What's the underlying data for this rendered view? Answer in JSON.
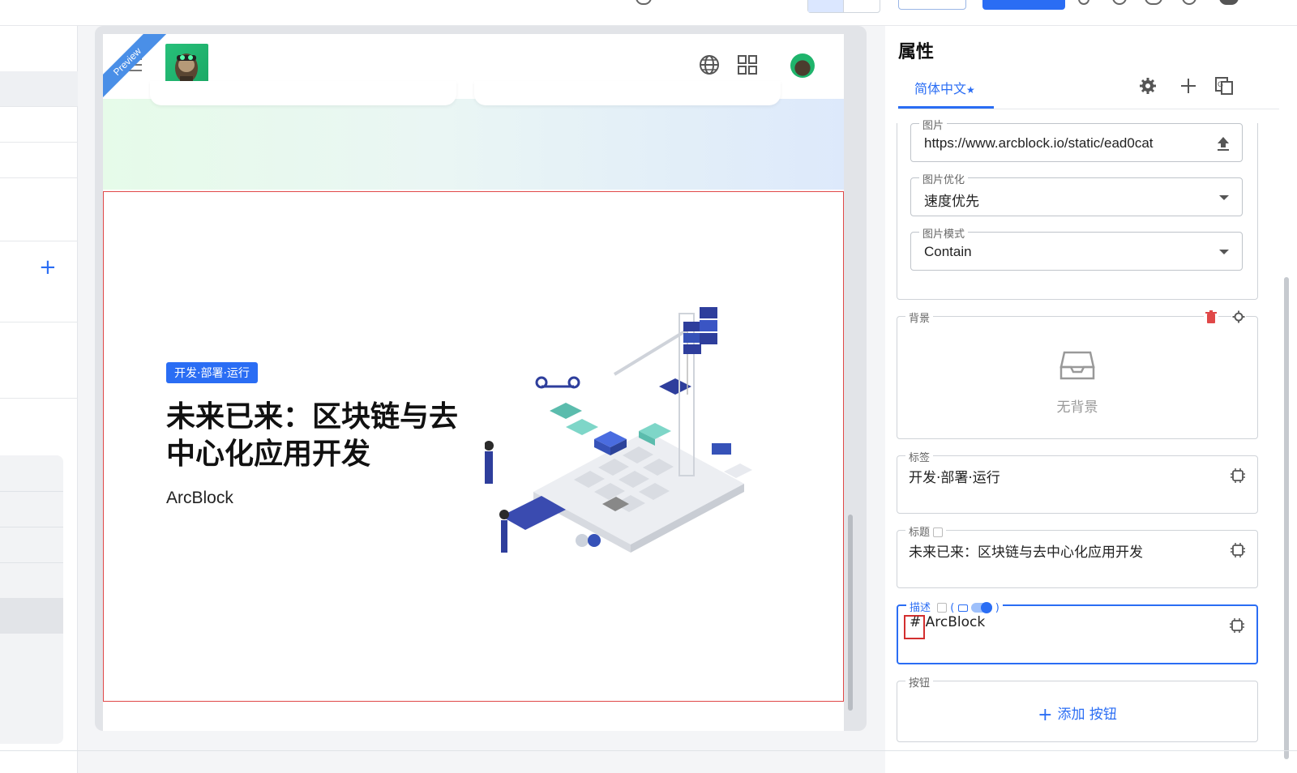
{
  "canvas": {
    "preview_label": "Preview",
    "hero": {
      "tag": "开发·部署·运行",
      "title": "未来已来：区块链与去中心化应用开发",
      "subtitle": "ArcBlock"
    }
  },
  "panel": {
    "title": "属性",
    "tab": "简体中文",
    "tab_marker": "★",
    "image_field": {
      "label": "图片",
      "value": "https://www.arcblock.io/static/ead0cat"
    },
    "optimize_field": {
      "label": "图片优化",
      "value": "速度优先"
    },
    "mode_field": {
      "label": "图片模式",
      "value": "Contain"
    },
    "background": {
      "label": "背景",
      "empty_text": "无背景"
    },
    "tag_section": {
      "label": "标签",
      "value": "开发·部署·运行"
    },
    "title_section": {
      "label": "标题",
      "value": "未来已来：区块链与去中心化应用开发"
    },
    "desc_section": {
      "label": "描述",
      "paren_open": "(",
      "paren_close": ")",
      "hash": "#",
      "value": "ArcBlock"
    },
    "button_section": {
      "label": "按钮",
      "add_label": "添加 按钮",
      "add_icon": "+"
    }
  },
  "colors": {
    "accent": "#2a6df4",
    "danger": "#e04848"
  },
  "icons": [
    "globe-icon",
    "grid-icon",
    "gear-icon",
    "plus-icon",
    "translate-icon",
    "upload-icon",
    "trash-icon",
    "inbox-icon",
    "ai-chip-icon"
  ]
}
